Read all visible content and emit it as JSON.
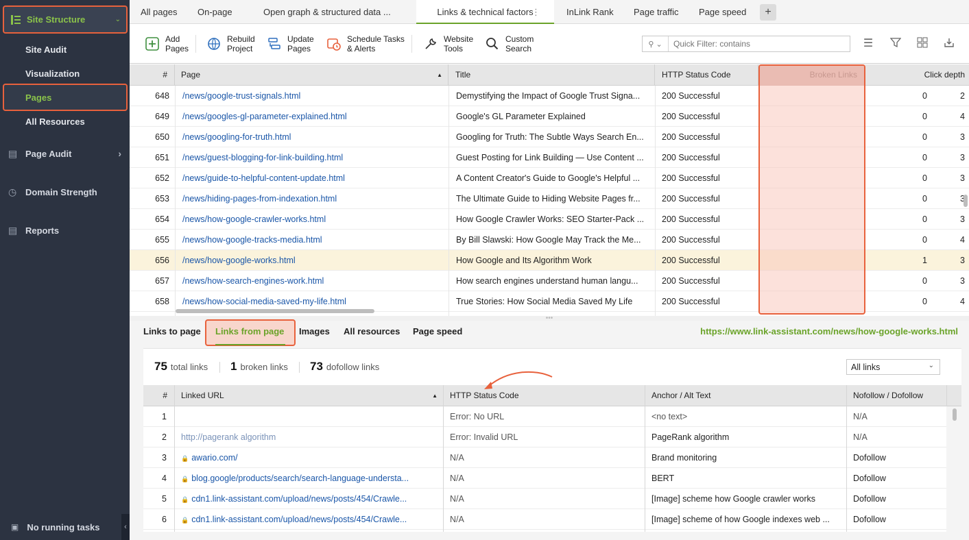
{
  "sidebar": {
    "top_label": "Site Structure",
    "sub_items": [
      "Site Audit",
      "Visualization",
      "Pages",
      "All Resources"
    ],
    "sections": [
      {
        "label": "Page Audit",
        "icon": "bar-chart-icon"
      },
      {
        "label": "Domain Strength",
        "icon": "gauge-icon"
      },
      {
        "label": "Reports",
        "icon": "report-icon"
      }
    ],
    "bottom": "No running tasks"
  },
  "tabs": [
    "All pages",
    "On-page",
    "Open graph & structured data ...",
    "Links & technical factors",
    "InLink Rank",
    "Page traffic",
    "Page speed"
  ],
  "toolbar": {
    "add": [
      "Add",
      "Pages"
    ],
    "rebuild": [
      "Rebuild",
      "Project"
    ],
    "update": [
      "Update",
      "Pages"
    ],
    "schedule": [
      "Schedule Tasks",
      "& Alerts"
    ],
    "website": [
      "Website",
      "Tools"
    ],
    "custom": [
      "Custom",
      "Search"
    ],
    "filter_placeholder": "Quick Filter: contains"
  },
  "top_grid": {
    "columns": [
      "#",
      "Page",
      "Title",
      "HTTP Status Code",
      "Broken Links",
      "Click depth"
    ],
    "rows": [
      {
        "num": "648",
        "page": "/news/google-trust-signals.html",
        "title": "Demystifying the Impact of Google Trust Signa...",
        "http": "200 Successful",
        "broken": "0",
        "depth": "2"
      },
      {
        "num": "649",
        "page": "/news/googles-gl-parameter-explained.html",
        "title": "Google's GL Parameter Explained",
        "http": "200 Successful",
        "broken": "0",
        "depth": "4"
      },
      {
        "num": "650",
        "page": "/news/googling-for-truth.html",
        "title": "Googling for Truth: The Subtle Ways Search En...",
        "http": "200 Successful",
        "broken": "0",
        "depth": "3"
      },
      {
        "num": "651",
        "page": "/news/guest-blogging-for-link-building.html",
        "title": "Guest Posting for Link Building — Use Content ...",
        "http": "200 Successful",
        "broken": "0",
        "depth": "3"
      },
      {
        "num": "652",
        "page": "/news/guide-to-helpful-content-update.html",
        "title": "A Content Creator's Guide to Google's Helpful ...",
        "http": "200 Successful",
        "broken": "0",
        "depth": "3"
      },
      {
        "num": "653",
        "page": "/news/hiding-pages-from-indexation.html",
        "title": "The Ultimate Guide to Hiding Website Pages fr...",
        "http": "200 Successful",
        "broken": "0",
        "depth": "3"
      },
      {
        "num": "654",
        "page": "/news/how-google-crawler-works.html",
        "title": "How Google Crawler Works: SEO Starter-Pack ...",
        "http": "200 Successful",
        "broken": "0",
        "depth": "3"
      },
      {
        "num": "655",
        "page": "/news/how-google-tracks-media.html",
        "title": "By Bill Slawski: How Google May Track the Me...",
        "http": "200 Successful",
        "broken": "0",
        "depth": "4"
      },
      {
        "num": "656",
        "page": "/news/how-google-works.html",
        "title": "How Google and Its Algorithm Work",
        "http": "200 Successful",
        "broken": "1",
        "depth": "3"
      },
      {
        "num": "657",
        "page": "/news/how-search-engines-work.html",
        "title": "How search engines understand human langu...",
        "http": "200 Successful",
        "broken": "0",
        "depth": "3"
      },
      {
        "num": "658",
        "page": "/news/how-social-media-saved-my-life.html",
        "title": "True Stories: How Social Media Saved My Life",
        "http": "200 Successful",
        "broken": "0",
        "depth": "4"
      }
    ],
    "selected_row": 8
  },
  "bottom_tabs": [
    "Links to page",
    "Links from page",
    "Images",
    "All resources",
    "Page speed"
  ],
  "page_url": "https://www.link-assistant.com/news/how-google-works.html",
  "summary": {
    "total_n": "75",
    "total_l": "total links",
    "broken_n": "1",
    "broken_l": "broken links",
    "dofollow_n": "73",
    "dofollow_l": "dofollow links",
    "filter": "All links"
  },
  "bottom_grid": {
    "columns": [
      "#",
      "Linked URL",
      "HTTP Status Code",
      "Anchor / Alt Text",
      "Nofollow / Dofollow"
    ],
    "rows": [
      {
        "num": "1",
        "url": "",
        "lock": false,
        "muted": false,
        "http": "Error: No URL",
        "anchor": "<no text>",
        "anchor_muted": true,
        "follow": "N/A",
        "follow_muted": true
      },
      {
        "num": "2",
        "url": "http://pagerank algorithm",
        "lock": false,
        "muted": true,
        "http": "Error: Invalid URL",
        "anchor": "PageRank algorithm",
        "anchor_muted": false,
        "follow": "N/A",
        "follow_muted": true
      },
      {
        "num": "3",
        "url": "awario.com/",
        "lock": true,
        "muted": false,
        "http": "N/A",
        "anchor": "Brand monitoring",
        "anchor_muted": false,
        "follow": "Dofollow",
        "follow_muted": false
      },
      {
        "num": "4",
        "url": "blog.google/products/search/search-language-understa...",
        "lock": true,
        "muted": false,
        "http": "N/A",
        "anchor": "BERT",
        "anchor_muted": false,
        "follow": "Dofollow",
        "follow_muted": false
      },
      {
        "num": "5",
        "url": "cdn1.link-assistant.com/upload/news/posts/454/Crawle...",
        "lock": true,
        "muted": false,
        "http": "N/A",
        "anchor": "[Image] scheme how Google crawler works",
        "anchor_muted": false,
        "follow": "Dofollow",
        "follow_muted": false
      },
      {
        "num": "6",
        "url": "cdn1.link-assistant.com/upload/news/posts/454/Crawle...",
        "lock": true,
        "muted": false,
        "http": "N/A",
        "anchor": "[Image] scheme of how Google indexes web ...",
        "anchor_muted": false,
        "follow": "Dofollow",
        "follow_muted": false
      }
    ]
  },
  "colors": {
    "accent_green": "#6aa329",
    "highlight_orange": "#e8613c",
    "sidebar_bg": "#2c3341",
    "link_blue": "#1a56a8"
  }
}
